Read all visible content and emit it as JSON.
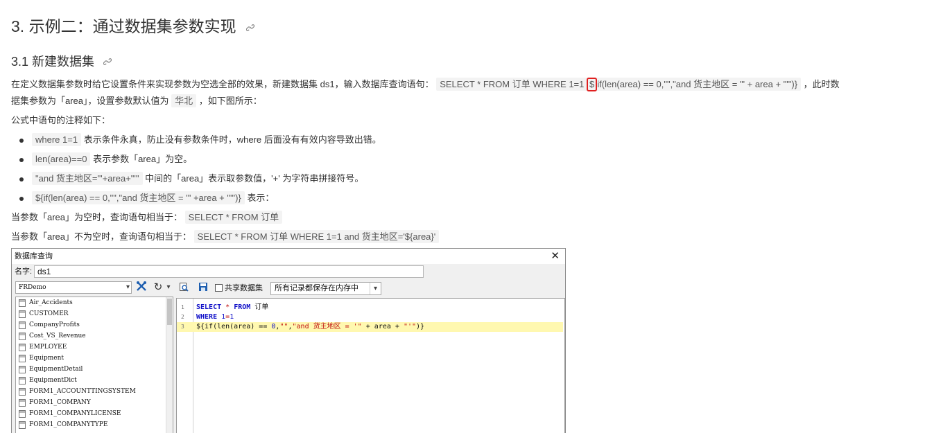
{
  "doc": {
    "title": "3. 示例二：通过数据集参数实现",
    "subtitle": "3.1 新建数据集",
    "link_icon": "link-icon",
    "para1": {
      "prefix": "在定义数据集参数时给它设置条件来实现参数为空选全部的效果，新建数据集 ds1，输入数据库查询语句：",
      "code_a": "SELECT * FROM 订单  WHERE 1=1",
      "code_dollar": "$",
      "code_b": "if(len(area) == 0,\"\",\"and 货主地区 = '\" + area + \"'\")}",
      "suffix": "，此时数"
    },
    "para2": {
      "prefix": "据集参数为「area」，设置参数默认值为",
      "code": "华北",
      "suffix": "，如下图所示："
    },
    "para3": "公式中语句的注释如下：",
    "notes": [
      {
        "code": "where 1=1",
        "text": "表示条件永真，防止没有参数条件时，where 后面没有有效内容导致出错。"
      },
      {
        "code": "len(area)==0",
        "text": "表示参数「area」为空。"
      },
      {
        "code": "\"and 货主地区='\"+area+\"'\"",
        "text": "中间的「area」表示取参数值，'+' 为字符串拼接符号。"
      },
      {
        "code": "${if(len(area) == 0,\"\",\"and 货主地区 = '\" +area + \"'\")}",
        "text": "表示："
      }
    ],
    "para4": {
      "prefix": "当参数「area」为空时，查询语句相当于：",
      "code": "SELECT * FROM 订单"
    },
    "para5": {
      "prefix": "当参数「area」不为空时，查询语句相当于：",
      "code": "SELECT * FROM 订单 WHERE 1=1 and 货主地区='${area}'"
    }
  },
  "dialog": {
    "title": "数据库查询",
    "close_icon": "close-icon",
    "name_label": "名字:",
    "name_value": "ds1",
    "datasource": "FRDemo",
    "tables": [
      "Air_Accidents",
      "CUSTOMER",
      "CompanyProfits",
      "Cost_VS_Revenue",
      "EMPLOYEE",
      "Equipment",
      "EquipmentDetail",
      "EquipmentDict",
      "FORM1_ACCOUNTTINGSYSTEM",
      "FORM1_COMPANY",
      "FORM1_COMPANYLICENSE",
      "FORM1_COMPANYTYPE"
    ],
    "share_label": "共享数据集",
    "memory_option": "所有记录都保存在内存中",
    "code_lines": [
      {
        "n": "1",
        "segments": [
          {
            "t": "SELECT",
            "c": "kw"
          },
          {
            "t": " * ",
            "c": "op"
          },
          {
            "t": "FROM",
            "c": "kw"
          },
          {
            "t": " 订单",
            "c": "plain"
          }
        ]
      },
      {
        "n": "2",
        "segments": [
          {
            "t": "WHERE",
            "c": "kw"
          },
          {
            "t": " 1",
            "c": "num"
          },
          {
            "t": "=",
            "c": "op"
          },
          {
            "t": "1",
            "c": "num"
          }
        ]
      },
      {
        "n": "3",
        "segments": [
          {
            "t": "${if(len(area) == ",
            "c": "plain"
          },
          {
            "t": "0",
            "c": "num"
          },
          {
            "t": ",",
            "c": "plain"
          },
          {
            "t": "\"\"",
            "c": "str"
          },
          {
            "t": ",",
            "c": "plain"
          },
          {
            "t": "\"and 货主地区 = '\"",
            "c": "str"
          },
          {
            "t": " + area + ",
            "c": "plain"
          },
          {
            "t": "\"'\"",
            "c": "str"
          },
          {
            "t": ")}",
            "c": "plain"
          }
        ]
      }
    ]
  }
}
